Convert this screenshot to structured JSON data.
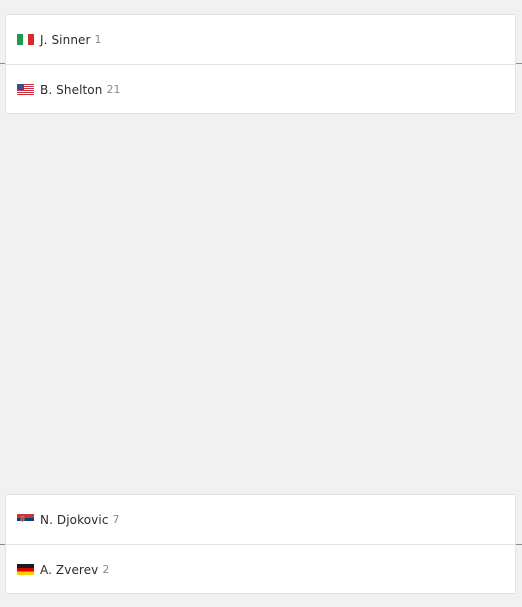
{
  "matches": [
    {
      "players": [
        {
          "name": "J. Sinner",
          "seed": "1",
          "flag_icon": "italy-flag-icon"
        },
        {
          "name": "B. Shelton",
          "seed": "21",
          "flag_icon": "usa-flag-icon"
        }
      ]
    },
    {
      "players": [
        {
          "name": "N. Djokovic",
          "seed": "7",
          "flag_icon": "serbia-flag-icon"
        },
        {
          "name": "A. Zverev",
          "seed": "2",
          "flag_icon": "germany-flag-icon"
        }
      ]
    }
  ],
  "colors": {
    "background": "#f1f1f1",
    "card": "#ffffff",
    "border": "#e2e2e2",
    "name_text": "#2b2b2b",
    "seed_text": "#8a8a8a"
  }
}
